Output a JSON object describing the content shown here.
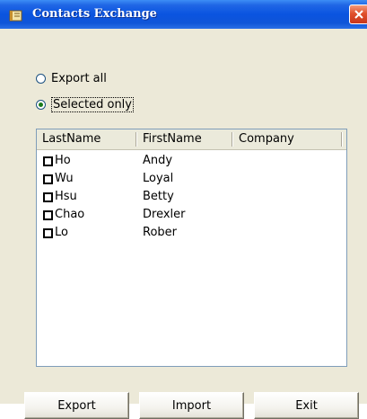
{
  "window": {
    "title": "Contacts Exchange"
  },
  "options": {
    "export_all": "Export all",
    "selected_only": "Selected only",
    "selected": "selected_only"
  },
  "list": {
    "columns": [
      "LastName",
      "FirstName",
      "Company"
    ],
    "rows": [
      {
        "last": "Ho",
        "first": "Andy",
        "company": "",
        "checked": false
      },
      {
        "last": "Wu",
        "first": "Loyal",
        "company": "",
        "checked": false
      },
      {
        "last": "Hsu",
        "first": "Betty",
        "company": "",
        "checked": false
      },
      {
        "last": "Chao",
        "first": "Drexler",
        "company": "",
        "checked": false
      },
      {
        "last": "Lo",
        "first": "Rober",
        "company": "",
        "checked": false
      }
    ]
  },
  "buttons": {
    "export": "Export",
    "import": "Import",
    "exit": "Exit"
  },
  "icons": {
    "title_icon": "book-icon",
    "close_icon": "close-icon"
  },
  "colors": {
    "titlebar": "#0a54e0",
    "window_face": "#ece9d8",
    "close_button": "#e0502c"
  }
}
